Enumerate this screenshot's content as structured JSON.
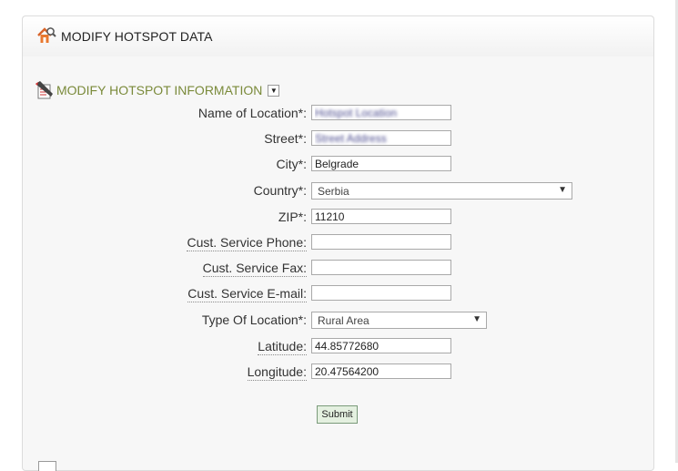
{
  "panel": {
    "title": "MODIFY HOTSPOT DATA",
    "header_icon": "home-search-icon"
  },
  "section": {
    "title": "MODIFY HOTSPOT INFORMATION",
    "toggle_glyph": "▼",
    "icon": "edit-document-icon"
  },
  "form": {
    "name_label": "Name of Location*:",
    "name_value": "Hotspot Location",
    "street_label": "Street*:",
    "street_value": "Street Address",
    "city_label": "City*:",
    "city_value": "Belgrade",
    "country_label": "Country*:",
    "country_value": "Serbia",
    "zip_label": "ZIP*:",
    "zip_value": "11210",
    "phone_label": "Cust. Service Phone:",
    "phone_value": "",
    "fax_label": "Cust. Service Fax:",
    "fax_value": "",
    "email_label": "Cust. Service E-mail:",
    "email_value": "",
    "type_label": "Type Of Location*:",
    "type_value": "Rural Area",
    "latitude_label": "Latitude:",
    "latitude_value": "44.85772680",
    "longitude_label": "Longitude:",
    "longitude_value": "20.47564200",
    "dropdown_arrow": "▼",
    "submit_label": "Submit"
  }
}
